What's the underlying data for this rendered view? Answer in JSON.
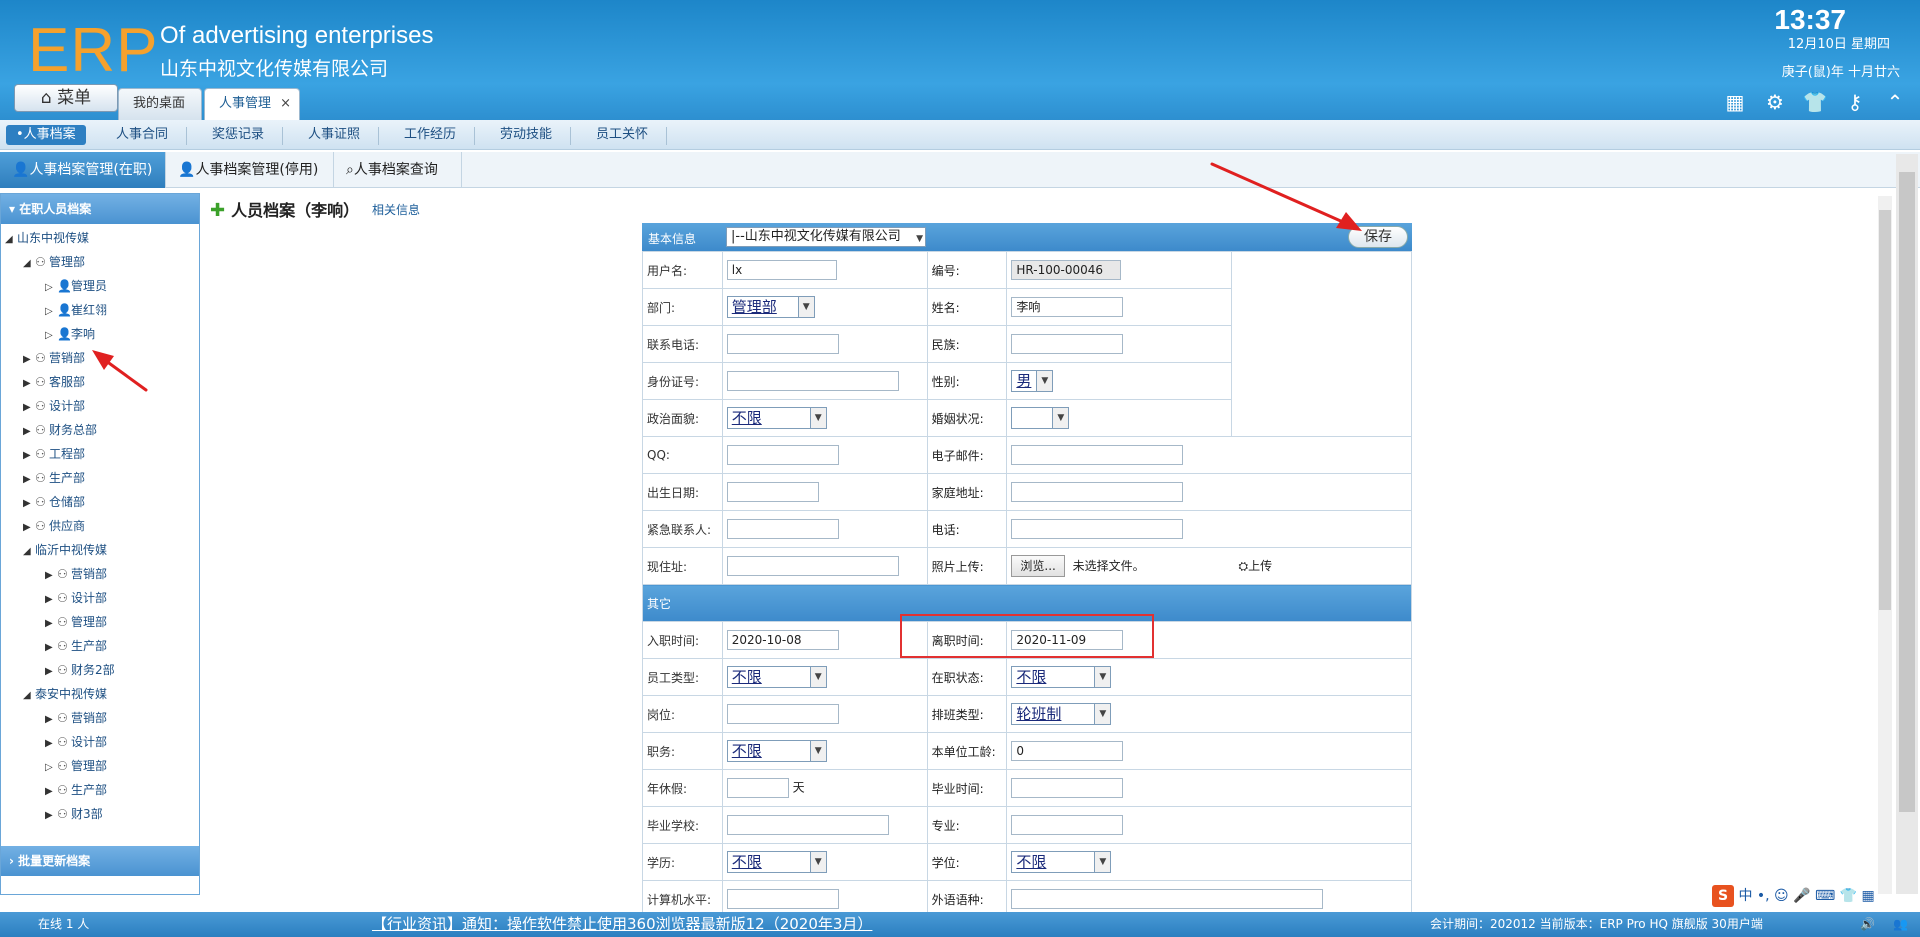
{
  "header": {
    "logo": "ERP",
    "slogan": "Of advertising enterprises",
    "company": "山东中视文化传媒有限公司",
    "time": "13:37",
    "date": "12月10日 星期四",
    "lunar": "庚子(鼠)年 十月廿六",
    "menu_label": "菜单",
    "tabs": [
      {
        "label": "我的桌面"
      },
      {
        "label": "人事管理",
        "close": "×"
      }
    ]
  },
  "nav2": [
    "•人事档案",
    "人事合同",
    "奖惩记录",
    "人事证照",
    "工作经历",
    "劳动技能",
    "员工关怀"
  ],
  "nav3": [
    "人事档案管理(在职)",
    "人事档案管理(停用)",
    "人事档案查询"
  ],
  "sidebar": {
    "title": "在职人员档案",
    "footer": "批量更新档案",
    "tree": [
      {
        "label": "山东中视传媒"
      },
      {
        "label": "管理部"
      },
      {
        "label": "管理员"
      },
      {
        "label": "崔红翎"
      },
      {
        "label": "李响"
      },
      {
        "label": "营销部"
      },
      {
        "label": "客服部"
      },
      {
        "label": "设计部"
      },
      {
        "label": "财务总部"
      },
      {
        "label": "工程部"
      },
      {
        "label": "生产部"
      },
      {
        "label": "仓储部"
      },
      {
        "label": "供应商"
      },
      {
        "label": "临沂中视传媒"
      },
      {
        "label": "营销部"
      },
      {
        "label": "设计部"
      },
      {
        "label": "管理部"
      },
      {
        "label": "生产部"
      },
      {
        "label": "财务2部"
      },
      {
        "label": "泰安中视传媒"
      },
      {
        "label": "营销部"
      },
      {
        "label": "设计部"
      },
      {
        "label": "管理部"
      },
      {
        "label": "生产部"
      },
      {
        "label": "财3部"
      }
    ]
  },
  "page": {
    "title": "人员档案（李响）",
    "related": "相关信息"
  },
  "form": {
    "section1": "基本信息",
    "company_select": "|--山东中视文化传媒有限公司",
    "save": "保存",
    "section2": "其它",
    "labels": {
      "username": "用户名:",
      "code": "编号:",
      "dept": "部门:",
      "name": "姓名:",
      "phone": "联系电话:",
      "ethnic": "民族:",
      "idcard": "身份证号:",
      "gender": "性别:",
      "politics": "政治面貌:",
      "marital": "婚姻状况:",
      "qq": "QQ:",
      "email": "电子邮件:",
      "birthday": "出生日期:",
      "home": "家庭地址:",
      "emergency": "紧急联系人:",
      "tel": "电话:",
      "address": "现住址:",
      "photo": "照片上传:",
      "hire": "入职时间:",
      "leave": "离职时间:",
      "emptype": "员工类型:",
      "status": "在职状态:",
      "post": "岗位:",
      "shift": "排班类型:",
      "duty": "职务:",
      "seniority": "本单位工龄:",
      "annual": "年休假:",
      "gradtime": "毕业时间:",
      "school": "毕业学校:",
      "major": "专业:",
      "edu": "学历:",
      "degree": "学位:",
      "computer": "计算机水平:",
      "language": "外语语种:"
    },
    "values": {
      "username": "lx",
      "code": "HR-100-00046",
      "dept": "管理部",
      "name": "李响",
      "gender": "男",
      "politics": "不限",
      "marital": "",
      "browse": "浏览...",
      "nofile": "未选择文件。",
      "upload": "上传",
      "hire": "2020-10-08",
      "leave": "2020-11-09",
      "emptype": "不限",
      "status": "不限",
      "shift": "轮班制",
      "duty": "不限",
      "seniority": "0",
      "annual_unit": "天",
      "edu": "不限",
      "degree": "不限"
    }
  },
  "status_bar": {
    "online": "在线  1  人",
    "notice": "【行业资讯】通知：操作软件禁止使用360浏览器最新版12（2020年3月）",
    "version": "会计期间：202012 当前版本：ERP Pro HQ 旗舰版 30用户端"
  },
  "ime": {
    "brand": "S",
    "mode": "中 •, ☺ 🎤 ⌨ 👕 ▦"
  },
  "colors": {
    "header": "#2d8fd0",
    "accent": "#3d8acb",
    "logo": "#f5a12d",
    "annotation": "#e02020"
  }
}
